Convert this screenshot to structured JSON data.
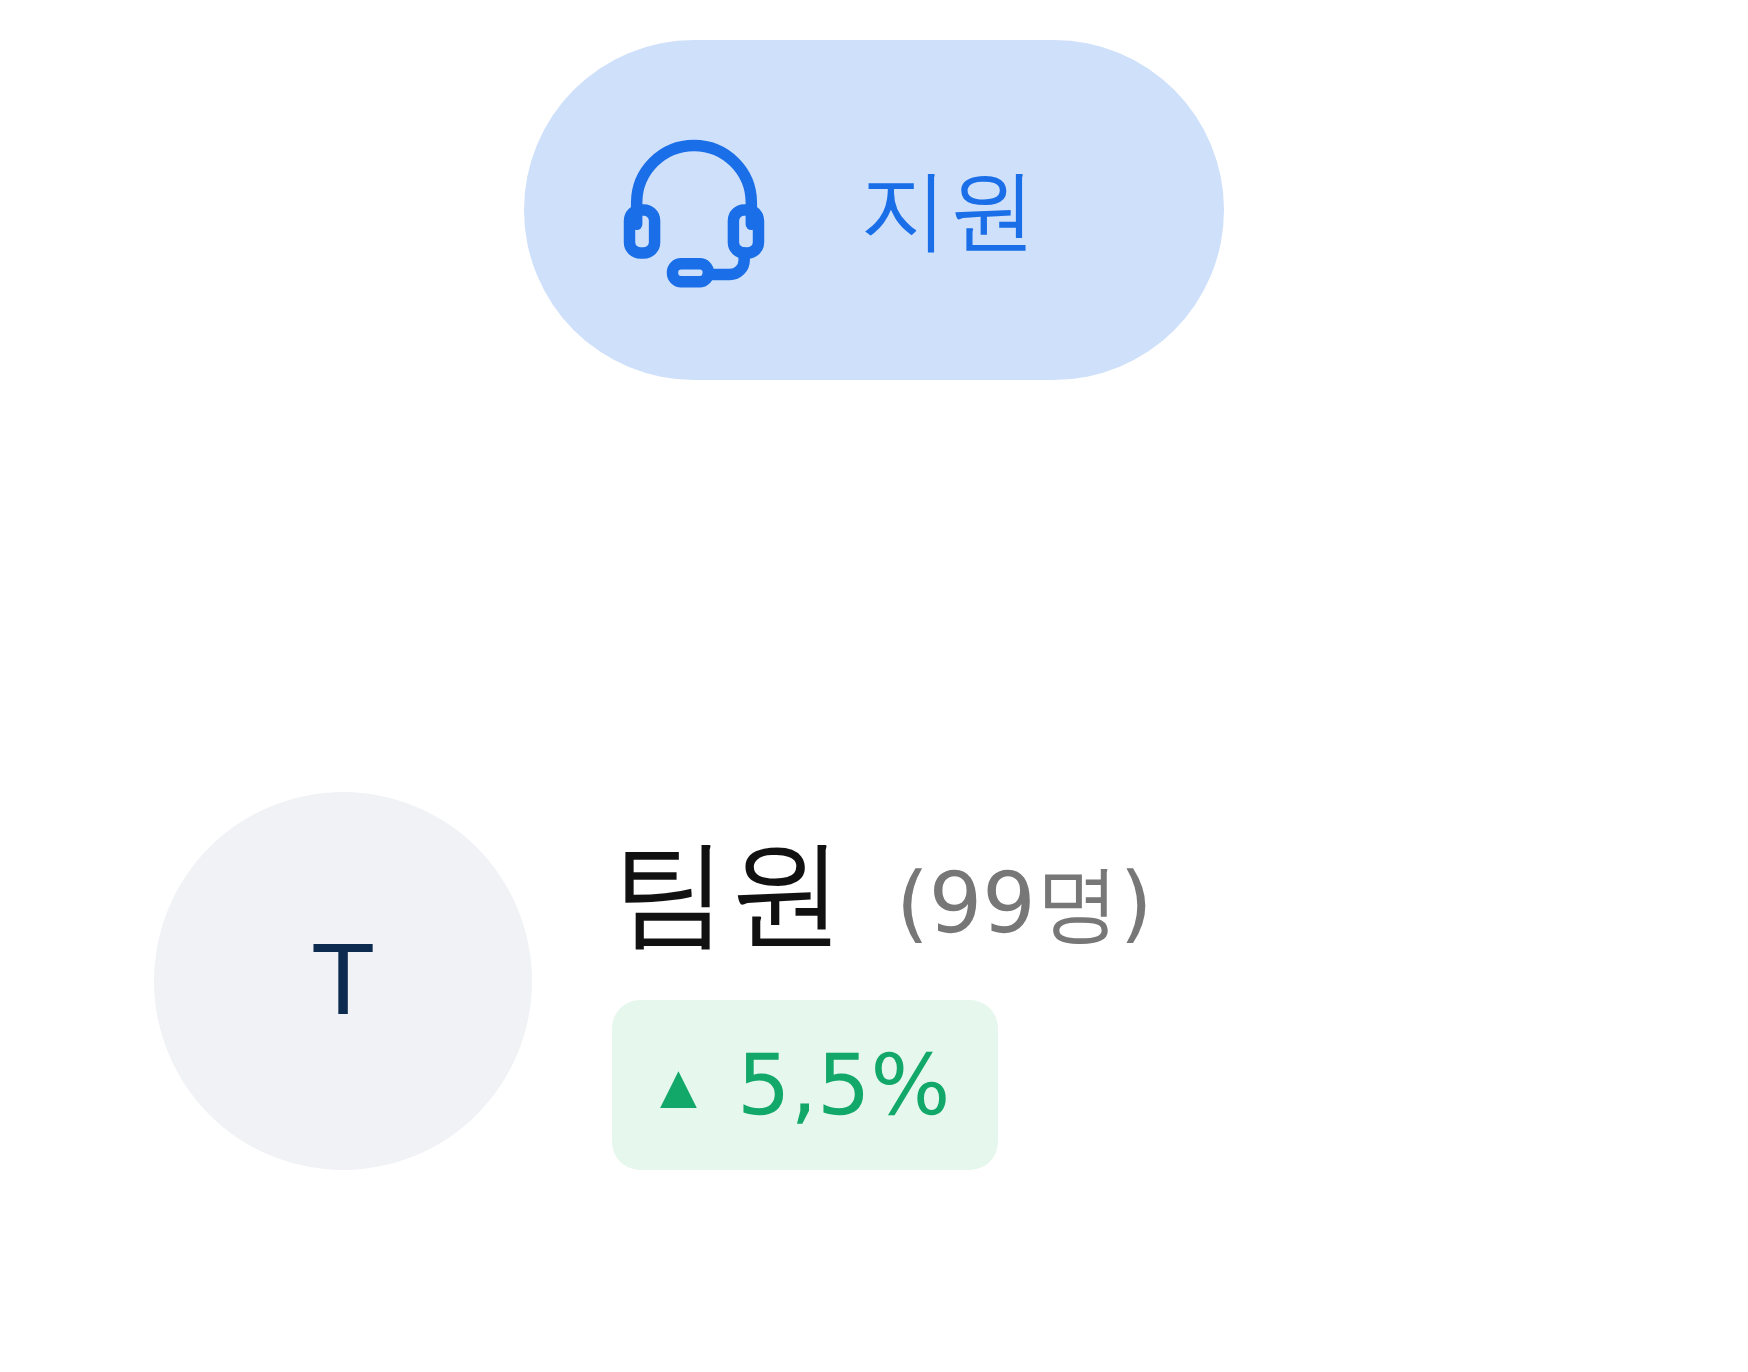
{
  "support_button": {
    "label": "지원"
  },
  "member": {
    "avatar_initial": "T",
    "title": "팀원",
    "count": "(99명)",
    "change": {
      "arrow": "▲",
      "value": "5,5%"
    }
  }
}
